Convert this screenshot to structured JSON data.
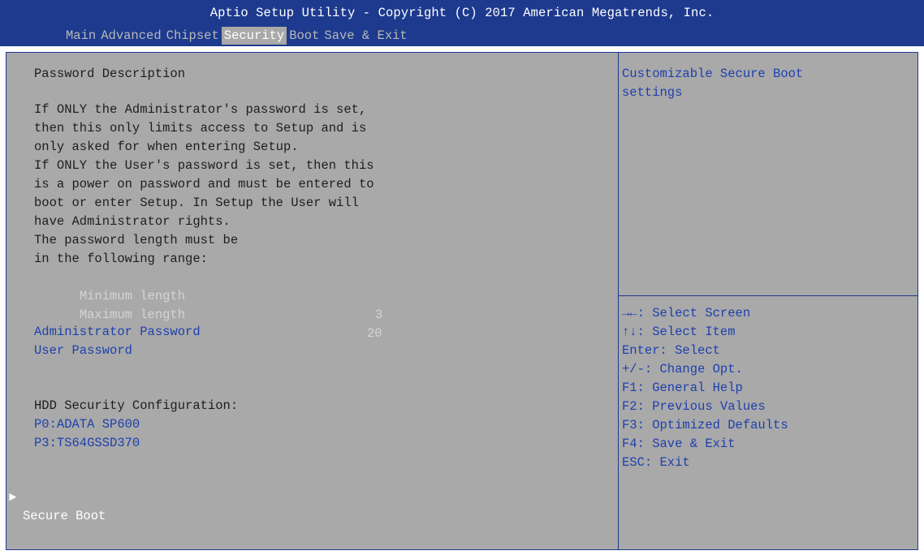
{
  "header": {
    "title": "Aptio Setup Utility - Copyright (C) 2017 American Megatrends, Inc.",
    "tabs": [
      "Main",
      "Advanced",
      "Chipset",
      "Security",
      "Boot",
      "Save & Exit"
    ],
    "active_tab": "Security"
  },
  "left": {
    "section_title": "Password Description",
    "description_lines": [
      "If ONLY the Administrator's password is set,",
      "then this only limits access to Setup and is",
      "only asked for when entering Setup.",
      "If ONLY the User's password is set, then this",
      "is a power on password and must be entered to",
      "boot or enter Setup. In Setup the User will",
      "have Administrator rights.",
      "The password length must be",
      "in the following range:"
    ],
    "min_length_label": "Minimum length",
    "min_length_value": "3",
    "max_length_label": "Maximum length",
    "max_length_value": "20",
    "admin_password_label": "Administrator Password",
    "user_password_label": "User Password",
    "hdd_heading": "HDD Security Configuration:",
    "hdd_items": [
      "P0:ADATA SP600",
      "P3:TS64GSSD370"
    ],
    "secure_boot_label": "Secure Boot",
    "submenu_arrow": "►"
  },
  "help": {
    "lines": [
      "Customizable Secure Boot",
      "settings"
    ]
  },
  "keys": [
    "→←: Select Screen",
    "↑↓: Select Item",
    "Enter: Select",
    "+/-: Change Opt.",
    "F1: General Help",
    "F2: Previous Values",
    "F3: Optimized Defaults",
    "F4: Save & Exit",
    "ESC: Exit"
  ],
  "colors": {
    "header_bg": "#1d3a8e",
    "panel_bg": "#a9a9a9",
    "accent_blue": "#1e40ad",
    "highlight_text": "#ffffff",
    "disabled_text": "#d4d4d4"
  }
}
